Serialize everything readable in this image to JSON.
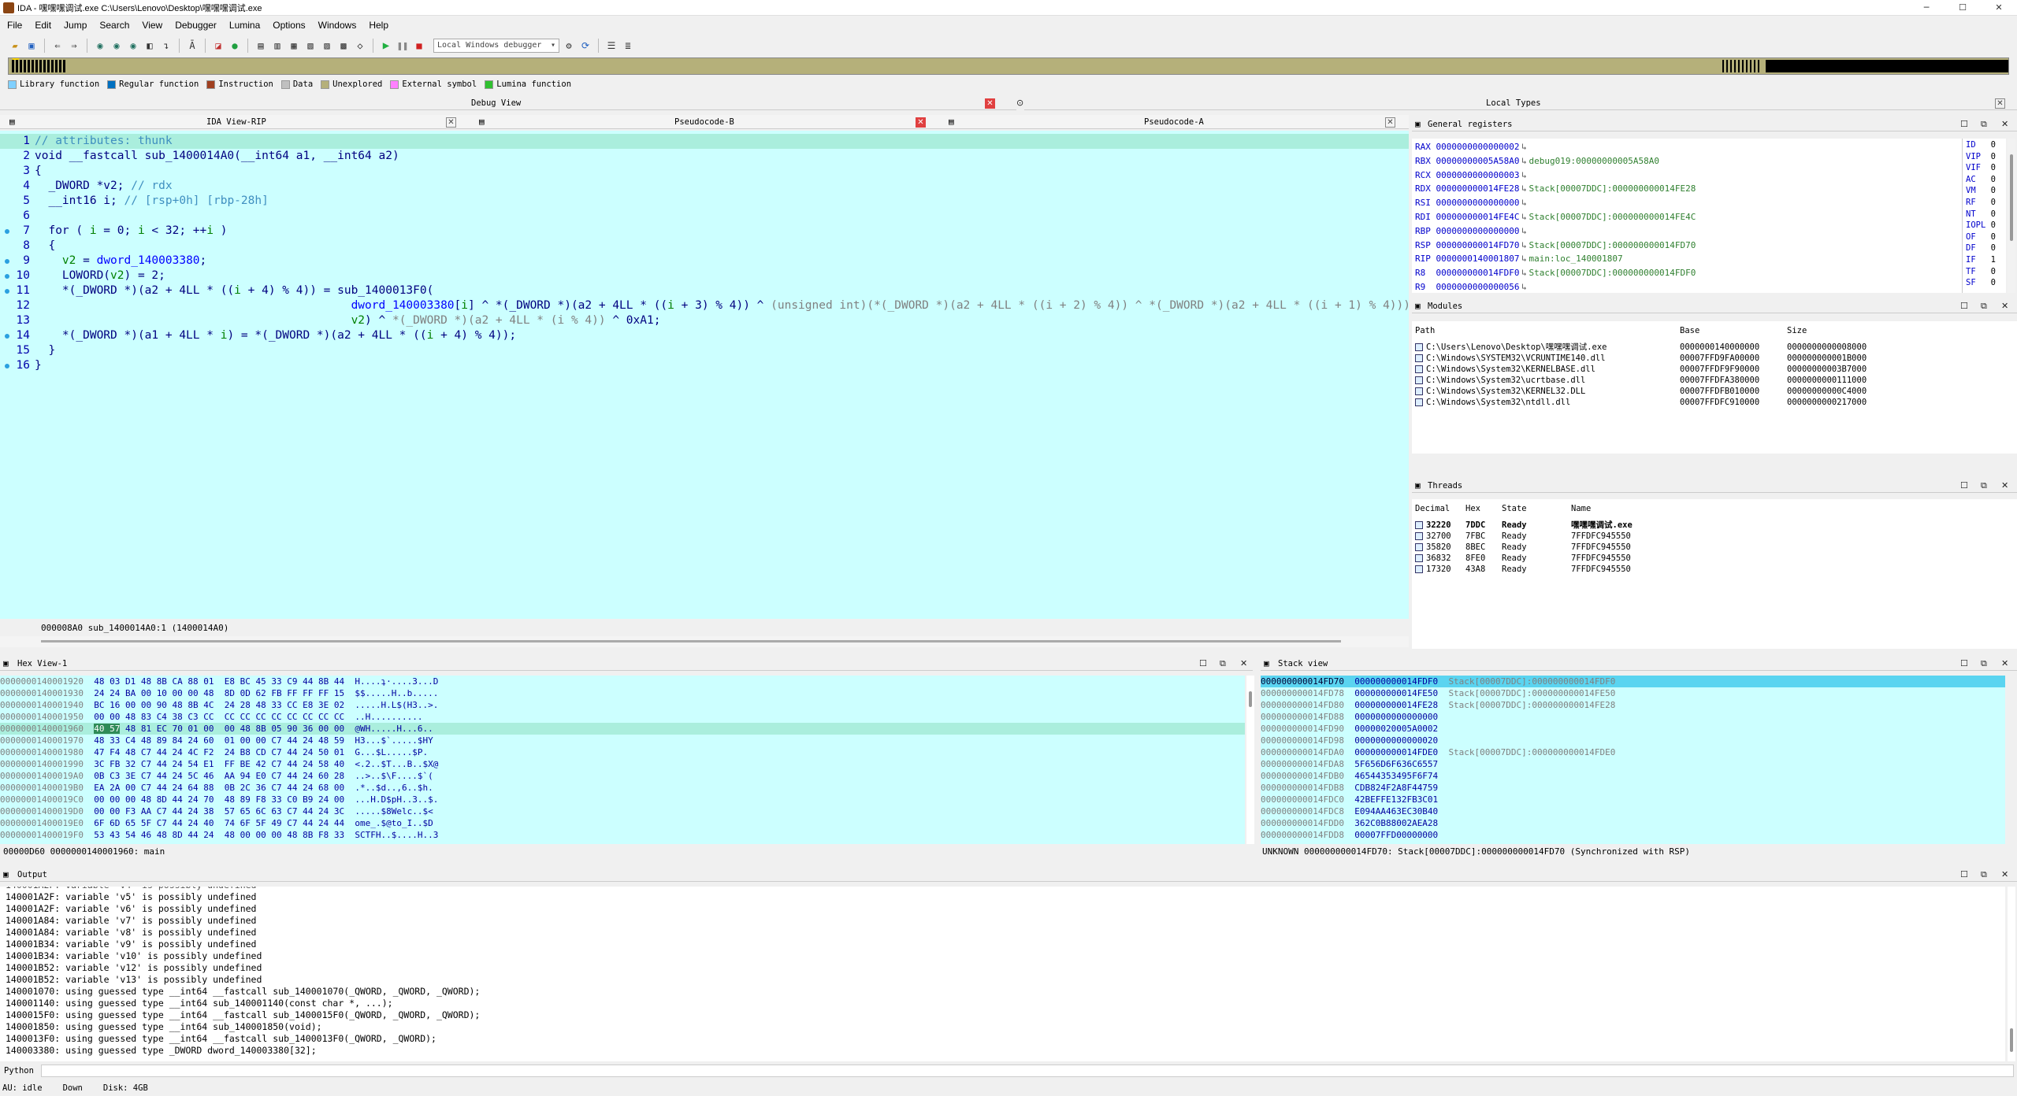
{
  "window": {
    "title": "IDA - 嘿嘿嘿调试.exe C:\\Users\\Lenovo\\Desktop\\嘿嘿嘿调试.exe",
    "min": "─",
    "max": "☐",
    "close": "✕"
  },
  "menu": [
    "File",
    "Edit",
    "Jump",
    "Search",
    "View",
    "Debugger",
    "Lumina",
    "Options",
    "Windows",
    "Help"
  ],
  "toolbar": {
    "debugger_select": "Local Windows debugger"
  },
  "legend": [
    {
      "label": "Library function",
      "color": "#80d0ff"
    },
    {
      "label": "Regular function",
      "color": "#0070c0"
    },
    {
      "label": "Instruction",
      "color": "#a04020"
    },
    {
      "label": "Data",
      "color": "#c0c0c0"
    },
    {
      "label": "Unexplored",
      "color": "#b5b07a"
    },
    {
      "label": "External symbol",
      "color": "#ff80ff"
    },
    {
      "label": "Lumina function",
      "color": "#30c030"
    }
  ],
  "views": {
    "debug_view": "Debug View",
    "local_types": "Local Types",
    "tab_ida_view": "IDA View-RIP",
    "tab_pseudo_b": "Pseudocode-B",
    "tab_pseudo_a": "Pseudocode-A",
    "general_registers": "General registers",
    "modules": "Modules",
    "threads": "Threads",
    "hex_view": "Hex View-1",
    "stack_view": "Stack view",
    "output": "Output"
  },
  "code": {
    "lines": [
      {
        "n": "1",
        "bp": false,
        "html": "<span class=\"c-cmt\">// attributes: thunk</span>"
      },
      {
        "n": "2",
        "bp": false,
        "html": "void __fastcall sub_1400014A0(__int64 a1, __int64 a2)"
      },
      {
        "n": "3",
        "bp": false,
        "html": "{"
      },
      {
        "n": "4",
        "bp": false,
        "html": "  _DWORD *v2; <span class=\"c-cmt\">// rdx</span>"
      },
      {
        "n": "5",
        "bp": false,
        "html": "  __int16 i; <span class=\"c-cmt\">// [rsp+0h] [rbp-28h]</span>"
      },
      {
        "n": "6",
        "bp": false,
        "html": ""
      },
      {
        "n": "7",
        "bp": true,
        "html": "  for ( <span class=\"c-var\">i</span> = 0; <span class=\"c-var\">i</span> &lt; 32; ++<span class=\"c-var\">i</span> )"
      },
      {
        "n": "8",
        "bp": false,
        "html": "  {"
      },
      {
        "n": "9",
        "bp": true,
        "html": "    <span class=\"c-var\">v2</span> = <span class=\"c-blue\">dword_140003380</span>;"
      },
      {
        "n": "10",
        "bp": true,
        "html": "    LOWORD(<span class=\"c-var\">v2</span>) = 2;"
      },
      {
        "n": "11",
        "bp": true,
        "html": "    *(_DWORD *)(a2 + 4LL * ((<span class=\"c-var\">i</span> + 4) % 4)) = sub_1400013F0("
      },
      {
        "n": "12",
        "bp": false,
        "html": "                                              <span class=\"c-blue\">dword_140003380</span>[<span class=\"c-var\">i</span>] ^ *(_DWORD *)(a2 + 4LL * ((<span class=\"c-var\">i</span> + 3) % 4)) ^ <span class=\"c-gray\">(unsigned int)(*(_DWORD *)(a2 + 4LL * ((i + 2) % 4)) ^ *(_DWORD *)(a2 + 4LL * ((i + 1) % 4)))</span>,"
      },
      {
        "n": "13",
        "bp": false,
        "html": "                                              <span class=\"c-var\">v2</span>) ^ <span class=\"c-gray\">*(_DWORD *)(a2 + 4LL * (i % 4))</span> ^ 0xA1;"
      },
      {
        "n": "14",
        "bp": true,
        "html": "    *(_DWORD *)(a1 + 4LL * <span class=\"c-var\">i</span>) = *(_DWORD *)(a2 + 4LL * ((<span class=\"c-var\">i</span> + 4) % 4));"
      },
      {
        "n": "15",
        "bp": false,
        "html": "  }"
      },
      {
        "n": "16",
        "bp": true,
        "html": "}"
      }
    ],
    "status": "000008A0 sub_1400014A0:1 (1400014A0)"
  },
  "registers": [
    {
      "name": "RAX",
      "value": "0000000000000002",
      "note": ""
    },
    {
      "name": "RBX",
      "value": "00000000005A58A0",
      "note": "debug019:00000000005A58A0"
    },
    {
      "name": "RCX",
      "value": "0000000000000003",
      "note": ""
    },
    {
      "name": "RDX",
      "value": "000000000014FE28",
      "note": "Stack[00007DDC]:000000000014FE28"
    },
    {
      "name": "RSI",
      "value": "0000000000000000",
      "note": ""
    },
    {
      "name": "RDI",
      "value": "000000000014FE4C",
      "note": "Stack[00007DDC]:000000000014FE4C"
    },
    {
      "name": "RBP",
      "value": "0000000000000000",
      "note": ""
    },
    {
      "name": "RSP",
      "value": "000000000014FD70",
      "note": "Stack[00007DDC]:000000000014FD70"
    },
    {
      "name": "RIP",
      "value": "0000000140001807",
      "note": "main:loc_140001807"
    },
    {
      "name": "R8 ",
      "value": "000000000014FDF0",
      "note": "Stack[00007DDC]:000000000014FDF0"
    },
    {
      "name": "R9 ",
      "value": "0000000000000056",
      "note": ""
    }
  ],
  "flags": [
    {
      "name": "ID",
      "value": "0"
    },
    {
      "name": "VIP",
      "value": "0"
    },
    {
      "name": "VIF",
      "value": "0"
    },
    {
      "name": "AC",
      "value": "0"
    },
    {
      "name": "VM",
      "value": "0"
    },
    {
      "name": "RF",
      "value": "0"
    },
    {
      "name": "NT",
      "value": "0"
    },
    {
      "name": "IOPL",
      "value": "0"
    },
    {
      "name": "OF",
      "value": "0"
    },
    {
      "name": "DF",
      "value": "0"
    },
    {
      "name": "IF",
      "value": "1"
    },
    {
      "name": "TF",
      "value": "0"
    },
    {
      "name": "SF",
      "value": "0"
    }
  ],
  "modules": {
    "headers": [
      "Path",
      "Base",
      "Size"
    ],
    "rows": [
      [
        "C:\\Users\\Lenovo\\Desktop\\嘿嘿嘿调试.exe",
        "0000000140000000",
        "0000000000008000"
      ],
      [
        "C:\\Windows\\SYSTEM32\\VCRUNTIME140.dll",
        "00007FFD9FA00000",
        "000000000001B000"
      ],
      [
        "C:\\Windows\\System32\\KERNELBASE.dll",
        "00007FFDF9F90000",
        "00000000003B7000"
      ],
      [
        "C:\\Windows\\System32\\ucrtbase.dll",
        "00007FFDFA380000",
        "0000000000111000"
      ],
      [
        "C:\\Windows\\System32\\KERNEL32.DLL",
        "00007FFDFB010000",
        "00000000000C4000"
      ],
      [
        "C:\\Windows\\System32\\ntdll.dll",
        "00007FFDFC910000",
        "0000000000217000"
      ]
    ]
  },
  "threads": {
    "headers": [
      "Decimal",
      "Hex",
      "State",
      "Name"
    ],
    "rows": [
      [
        "32220",
        "7DDC",
        "Ready",
        "嘿嘿嘿调试.exe"
      ],
      [
        "32700",
        "7FBC",
        "Ready",
        "7FFDFC945550"
      ],
      [
        "35820",
        "8BEC",
        "Ready",
        "7FFDFC945550"
      ],
      [
        "36832",
        "8FE0",
        "Ready",
        "7FFDFC945550"
      ],
      [
        "17320",
        "43A8",
        "Ready",
        "7FFDFC945550"
      ]
    ]
  },
  "hex": {
    "lines": [
      {
        "addr": "0000000140001920",
        "bytes": "48 03 D1 48 8B CA 88 01  E8 BC 45 33 C9 44 8B 44",
        "ascii": "H....ʇ·....3...D",
        "hl": false
      },
      {
        "addr": "0000000140001930",
        "bytes": "24 24 BA 00 10 00 00 48  8D 0D 62 FB FF FF FF 15",
        "ascii": "$$.....H..b.....",
        "hl": false
      },
      {
        "addr": "0000000140001940",
        "bytes": "BC 16 00 00 90 48 8B 4C  24 28 48 33 CC E8 3E 02",
        "ascii": ".....H.L$(H3..>.",
        "hl": false
      },
      {
        "addr": "0000000140001950",
        "bytes": "00 00 48 83 C4 38 C3 CC  CC CC CC CC CC CC CC CC",
        "ascii": "..H..........",
        "hl": false
      },
      {
        "addr": "0000000140001960",
        "bytes": "40 57 48 81 EC 70 01 00  00 48 8B 05 90 36 00 00",
        "ascii": "@WH.....H...6..",
        "hl": true
      },
      {
        "addr": "0000000140001970",
        "bytes": "48 33 C4 48 89 84 24 60  01 00 00 C7 44 24 48 59",
        "ascii": "H3...$`.....$HY",
        "hl": false
      },
      {
        "addr": "0000000140001980",
        "bytes": "47 F4 48 C7 44 24 4C F2  24 B8 CD C7 44 24 50 01",
        "ascii": "G...$L.....$P.",
        "hl": false
      },
      {
        "addr": "0000000140001990",
        "bytes": "3C FB 32 C7 44 24 54 E1  FF BE 42 C7 44 24 58 40",
        "ascii": "<.2..$T...B..$X@",
        "hl": false
      },
      {
        "addr": "00000001400019A0",
        "bytes": "0B C3 3E C7 44 24 5C 46  AA 94 E0 C7 44 24 60 28",
        "ascii": "..>..$\\F....$`(",
        "hl": false
      },
      {
        "addr": "00000001400019B0",
        "bytes": "EA 2A 00 C7 44 24 64 88  0B 2C 36 C7 44 24 68 00",
        "ascii": ".*..$d..,6..$h.",
        "hl": false
      },
      {
        "addr": "00000001400019C0",
        "bytes": "00 00 00 48 8D 44 24 70  48 89 F8 33 C0 B9 24 00",
        "ascii": "...H.D$pH..3..$.",
        "hl": false
      },
      {
        "addr": "00000001400019D0",
        "bytes": "00 00 F3 AA C7 44 24 38  57 65 6C 63 C7 44 24 3C",
        "ascii": ".....$8Welc..$<",
        "hl": false
      },
      {
        "addr": "00000001400019E0",
        "bytes": "6F 6D 65 5F C7 44 24 40  74 6F 5F 49 C7 44 24 44",
        "ascii": "ome_.$@to_I..$D",
        "hl": false
      },
      {
        "addr": "00000001400019F0",
        "bytes": "53 43 54 46 48 8D 44 24  48 00 00 00 48 8B F8 33",
        "ascii": "SCTFH..$....H..3",
        "hl": false
      }
    ],
    "status": "00000D60 0000000140001960: main"
  },
  "stack": {
    "lines": [
      {
        "addr": "000000000014FD70",
        "val": "000000000014FDF0",
        "note": "Stack[00007DDC]:000000000014FDF0",
        "hl": true
      },
      {
        "addr": "000000000014FD78",
        "val": "000000000014FE50",
        "note": "Stack[00007DDC]:000000000014FE50",
        "hl": false
      },
      {
        "addr": "000000000014FD80",
        "val": "000000000014FE28",
        "note": "Stack[00007DDC]:000000000014FE28",
        "hl": false
      },
      {
        "addr": "000000000014FD88",
        "val": "0000000000000000",
        "note": "",
        "hl": false
      },
      {
        "addr": "000000000014FD90",
        "val": "00000020005A0002",
        "note": "",
        "hl": false
      },
      {
        "addr": "000000000014FD98",
        "val": "0000000000000020",
        "note": "",
        "hl": false
      },
      {
        "addr": "000000000014FDA0",
        "val": "000000000014FDE0",
        "note": "Stack[00007DDC]:000000000014FDE0",
        "hl": false
      },
      {
        "addr": "000000000014FDA8",
        "val": "5F656D6F636C6557",
        "note": "",
        "hl": false
      },
      {
        "addr": "000000000014FDB0",
        "val": "46544353495F6F74",
        "note": "",
        "hl": false
      },
      {
        "addr": "000000000014FDB8",
        "val": "CDB824F2A8F44759",
        "note": "",
        "hl": false
      },
      {
        "addr": "000000000014FDC0",
        "val": "42BEFFE132FB3C01",
        "note": "",
        "hl": false
      },
      {
        "addr": "000000000014FDC8",
        "val": "E094AA463EC30B40",
        "note": "",
        "hl": false
      },
      {
        "addr": "000000000014FDD0",
        "val": "362C0B88002AEA28",
        "note": "",
        "hl": false
      },
      {
        "addr": "000000000014FDD8",
        "val": "00007FFD00000000",
        "note": "",
        "hl": false
      }
    ],
    "status": "UNKNOWN 000000000014FD70: Stack[00007DDC]:000000000014FD70 (Synchronized with RSP)"
  },
  "output": {
    "lines": [
      "140001A2F: variable 'v5' is possibly undefined",
      "140001A2F: variable 'v6' is possibly undefined",
      "140001A84: variable 'v7' is possibly undefined",
      "140001A84: variable 'v8' is possibly undefined",
      "140001B34: variable 'v9' is possibly undefined",
      "140001B34: variable 'v10' is possibly undefined",
      "140001B52: variable 'v12' is possibly undefined",
      "140001B52: variable 'v13' is possibly undefined",
      "140001070: using guessed type __int64 __fastcall sub_140001070(_QWORD, _QWORD, _QWORD);",
      "140001140: using guessed type __int64 sub_140001140(const char *, ...);",
      "1400015F0: using guessed type __int64 __fastcall sub_1400015F0(_QWORD, _QWORD, _QWORD);",
      "140001850: using guessed type __int64 sub_140001850(void);",
      "1400013F0: using guessed type __int64 __fastcall sub_1400013F0(_QWORD, _QWORD);",
      "140003380: using guessed type _DWORD dword_140003380[32];"
    ],
    "lang": "Python"
  },
  "statusbar": {
    "au": "AU:  idle",
    "dir": "Down",
    "disk": "Disk: 4GB"
  }
}
